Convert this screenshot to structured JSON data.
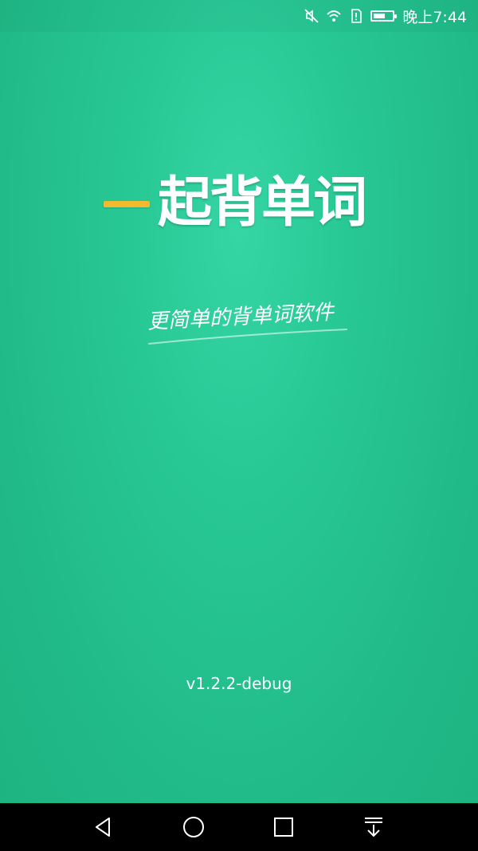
{
  "status_bar": {
    "time": "晚上7:44",
    "icons": [
      "mute-icon",
      "wifi-icon",
      "sim-alert-icon",
      "battery-icon"
    ]
  },
  "splash": {
    "app_title": "一起背单词",
    "app_title_rest": "起背单词",
    "slogan": "更简单的背单词软件",
    "version": "v1.2.2-debug",
    "colors": {
      "background": "#27c793",
      "accent_dash": "#f3b92f",
      "text": "#ffffff"
    }
  },
  "nav_bar": {
    "buttons": [
      "back-icon",
      "home-icon",
      "recents-icon",
      "notification-pull-icon"
    ]
  }
}
